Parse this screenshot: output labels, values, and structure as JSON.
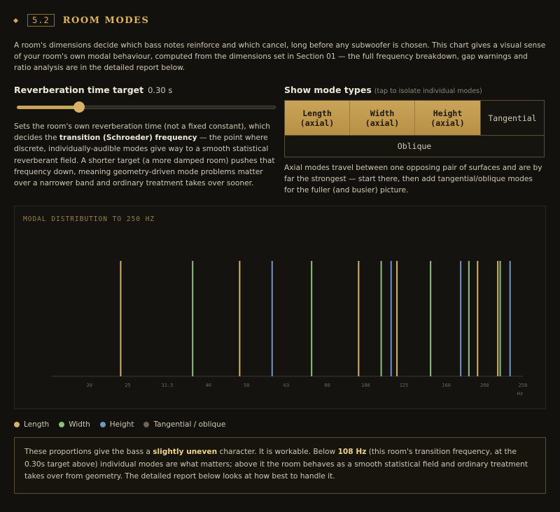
{
  "section": {
    "number": "5.2",
    "title": "ROOM MODES",
    "intro": "A room's dimensions decide which bass notes reinforce and which cancel, long before any subwoofer is chosen. This chart gives a visual sense of your room's own modal behaviour, computed from the dimensions set in Section 01 — the full frequency breakdown, gap warnings and ratio analysis are in the detailed report below."
  },
  "reverb": {
    "label": "Reverberation time target",
    "value_text": "0.30 s",
    "value_fraction": 0.24,
    "desc_before": "Sets the room's own reverberation time (not a fixed constant), which decides the ",
    "desc_bold": "transition (Schroeder) frequency",
    "desc_after": " — the point where discrete, individually-audible modes give way to a smooth statistical reverberant field. A shorter target (a more damped room) pushes that frequency down, meaning geometry-driven mode problems matter over a narrower band and ordinary treatment takes over sooner."
  },
  "mode_types": {
    "label": "Show mode types",
    "hint": "(tap to isolate individual modes)",
    "buttons": [
      {
        "line1": "Length",
        "line2": "(axial)",
        "active": true
      },
      {
        "line1": "Width",
        "line2": "(axial)",
        "active": true
      },
      {
        "line1": "Height",
        "line2": "(axial)",
        "active": true
      },
      {
        "line1": "Tangential",
        "line2": "",
        "active": false
      },
      {
        "line1": "Oblique",
        "line2": "",
        "active": false
      }
    ],
    "desc": "Axial modes travel between one opposing pair of surfaces and are by far the strongest — start there, then add tangential/oblique modes for the fuller (and busier) picture."
  },
  "colors": {
    "length": "#d6b36a",
    "width": "#8fbf7e",
    "height": "#6f96c4",
    "tangential": "#6e6452"
  },
  "chart_data": {
    "type": "bar",
    "title": "MODAL DISTRIBUTION TO 250 HZ",
    "xscale": "log",
    "xlim": [
      16,
      250
    ],
    "xlabel": "Hz",
    "xticks": [
      20,
      25,
      31.5,
      40,
      50,
      63,
      80,
      100,
      125,
      160,
      200,
      250
    ],
    "xtick_labels": [
      "20",
      "25",
      "31.5",
      "40",
      "50",
      "63",
      "80",
      "100",
      "125",
      "160",
      "200",
      "250"
    ],
    "ylim": [
      0,
      1
    ],
    "grid": false,
    "series": [
      {
        "key": "length",
        "x": [
          24,
          48,
          96,
          120,
          192,
          216
        ],
        "values": [
          1,
          1,
          1,
          1,
          1,
          1
        ]
      },
      {
        "key": "width",
        "x": [
          36.5,
          73,
          109.5,
          146,
          182.5,
          219
        ],
        "values": [
          1,
          1,
          1,
          1,
          1,
          1
        ]
      },
      {
        "key": "height",
        "x": [
          58,
          116,
          174,
          232
        ],
        "values": [
          1,
          1,
          1,
          1
        ]
      }
    ]
  },
  "legend": [
    {
      "label": "Length",
      "color_key": "length"
    },
    {
      "label": "Width",
      "color_key": "width"
    },
    {
      "label": "Height",
      "color_key": "height"
    },
    {
      "label": "Tangential / oblique",
      "color_key": "tangential"
    }
  ],
  "summary": {
    "t1": "These proportions give the bass a ",
    "b1": "slightly uneven",
    "t2": " character. It is workable. Below ",
    "b2": "108 Hz",
    "t3": " (this room's transition frequency, at the 0.30s target above) individual modes are what matters; above it the room behaves as a smooth statistical field and ordinary treatment takes over from geometry. The detailed report below looks at how best to handle it."
  }
}
